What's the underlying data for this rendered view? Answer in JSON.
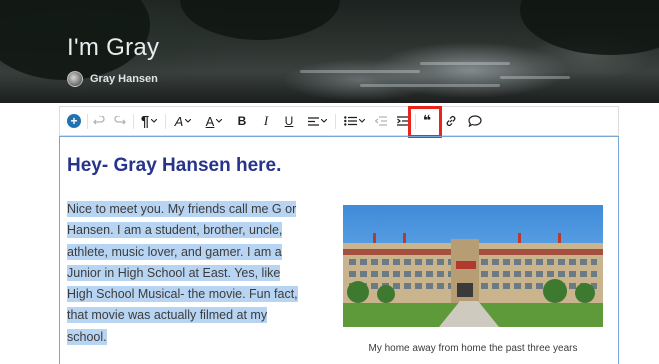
{
  "header": {
    "site_title": "I'm Gray",
    "author_name": "Gray Hansen"
  },
  "toolbar": {
    "items": [
      {
        "name": "add-block",
        "icon": "plus-circle-icon"
      },
      {
        "name": "undo",
        "icon": "undo-icon",
        "disabled": true
      },
      {
        "name": "redo",
        "icon": "redo-icon",
        "disabled": true
      },
      {
        "name": "paragraph",
        "icon": "pilcrow-icon",
        "glyph": "¶"
      },
      {
        "name": "font-size",
        "icon": "text-size-icon",
        "glyph": "A"
      },
      {
        "name": "text-color",
        "icon": "text-color-icon",
        "glyph": "A"
      },
      {
        "name": "bold",
        "icon": "bold-icon",
        "glyph": "B"
      },
      {
        "name": "italic",
        "icon": "italic-icon",
        "glyph": "I"
      },
      {
        "name": "underline",
        "icon": "underline-icon",
        "glyph": "U"
      },
      {
        "name": "align",
        "icon": "align-left-icon"
      },
      {
        "name": "list",
        "icon": "bulleted-list-icon"
      },
      {
        "name": "outdent",
        "icon": "outdent-icon",
        "disabled": true
      },
      {
        "name": "indent",
        "icon": "indent-icon"
      },
      {
        "name": "blockquote",
        "icon": "quote-icon",
        "glyph": "❝",
        "highlighted": true
      },
      {
        "name": "link",
        "icon": "link-icon"
      },
      {
        "name": "comment",
        "icon": "comment-icon"
      }
    ],
    "highlight_color": "#e8241b"
  },
  "content": {
    "heading": "Hey- Gray Hansen here.",
    "paragraph_lines": [
      "Nice to meet you. My friends call me G or",
      "Hansen. I am a student, brother, uncle,",
      "athlete, music lover, and gamer. I am a",
      "Junior in High School at East. Yes, like",
      "High School Musical- the movie. Fun fact,",
      "that movie was actually filmed at my",
      "school."
    ],
    "image_caption": "My home away from home the past three years",
    "selection_color": "#b7d4f3",
    "heading_color": "#27348b"
  }
}
